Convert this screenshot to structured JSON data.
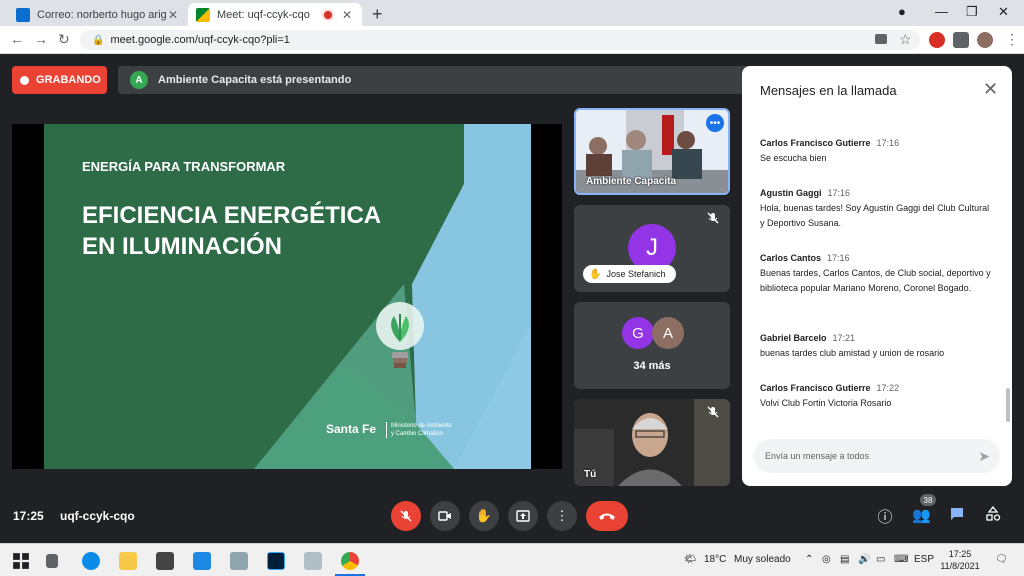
{
  "browser": {
    "tabs": [
      {
        "title": "Correo: norberto hugo arigone -",
        "active": false
      },
      {
        "title": "Meet: uqf-ccyk-cqo",
        "active": true
      }
    ],
    "url": "meet.google.com/uqf-ccyk-cqo?pli=1",
    "new_tab": "+",
    "close": "✕"
  },
  "meet": {
    "recording_label": "GRABANDO",
    "presenter_initial": "A",
    "presenting_text": "Ambiente Capacita está presentando",
    "slide": {
      "subtitle": "ENERGÍA PARA TRANSFORMAR",
      "title_line1": "EFICIENCIA ENERGÉTICA",
      "title_line2": "EN ILUMINACIÓN",
      "logo": "Santa Fe",
      "ministry_line1": "Ministerio de Ambiente",
      "ministry_line2": "y Cambio Climático"
    },
    "participants": [
      {
        "label": "Ambiente Capacita"
      },
      {
        "initial": "J",
        "name": "Jose Stefanich"
      },
      {
        "initials": [
          "G",
          "A"
        ],
        "more": "34 más"
      },
      {
        "label": "Tú"
      }
    ],
    "meeting_time": "17:25",
    "meeting_code": "uqf-ccyk-cqo",
    "participant_count": "38",
    "colors": {
      "accent": "#1a73e8",
      "danger": "#ea4335",
      "bg": "#202124"
    }
  },
  "chat": {
    "title": "Mensajes en la llamada",
    "messages": [
      {
        "sender": "Carlos Francisco Gutierre",
        "time": "17:16",
        "text": "Se escucha bien"
      },
      {
        "sender": "Agustin Gaggi",
        "time": "17:16",
        "text": "Hola, buenas tardes! Soy Agustín Gaggi del Club Cultural y Deportivo Susana."
      },
      {
        "sender": "Carlos Cantos",
        "time": "17:16",
        "text": "Buenas tardes, Carlos Cantos, de Club social, deportivo y biblioteca popular Mariano Moreno, Coronel Bogado."
      },
      {
        "sender": "Gabriel Barcelo",
        "time": "17:21",
        "text": "buenas tardes club amistad y union de rosario"
      },
      {
        "sender": "Carlos Francisco Gutierre",
        "time": "17:22",
        "text": "Volvi Club Fortin Victoria Rosario"
      }
    ],
    "input_placeholder": "Envía un mensaje a todos"
  },
  "taskbar": {
    "temperature": "18°C",
    "weather": "Muy soleado",
    "language": "ESP",
    "time": "17:25",
    "date": "11/8/2021"
  }
}
